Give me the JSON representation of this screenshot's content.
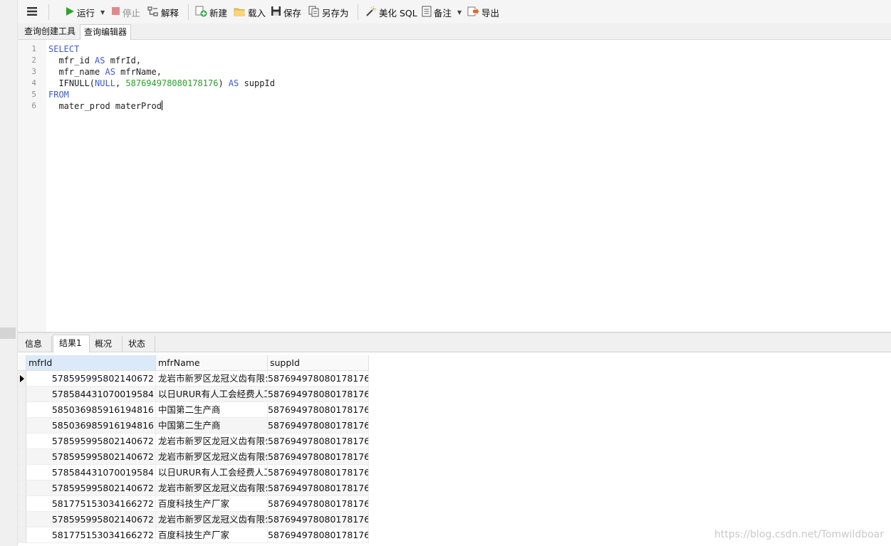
{
  "toolbar": {
    "run": "运行",
    "stop": "停止",
    "explain": "解释",
    "new": "新建",
    "load": "载入",
    "save": "保存",
    "save_as": "另存为",
    "beautify": "美化 SQL",
    "notes": "备注",
    "export": "导出",
    "colors": {
      "run_icon": "#2fa22f",
      "stop_icon": "#e08a8a",
      "new_icon": "#3aa54a",
      "export_icon": "#e06a28"
    }
  },
  "top_tabs": [
    "查询创建工具",
    "查询编辑器"
  ],
  "editor": {
    "line_numbers": [
      "1",
      "2",
      "3",
      "4",
      "5",
      "6"
    ],
    "l1_kw": "SELECT",
    "l2_a": "  mfr_id ",
    "l2_kw": "AS",
    "l2_b": " mfrId,",
    "l3_a": "  mfr_name ",
    "l3_kw": "AS",
    "l3_b": " mfrName,",
    "l4_a": "  IFNULL(",
    "l4_null": "NULL",
    "l4_comma": ", ",
    "l4_num": "587694978080178176",
    "l4_close": ") ",
    "l4_kw": "AS",
    "l4_b": " suppId",
    "l5_kw": "FROM",
    "l6": "  mater_prod materProd",
    "colors": {
      "keyword": "#3a5bcf",
      "number": "#2aa02a"
    }
  },
  "result_tabs": [
    "信息",
    "结果1",
    "概况",
    "状态"
  ],
  "grid": {
    "columns": [
      "mfrId",
      "mfrName",
      "suppId"
    ],
    "rows": [
      [
        "578595995802140672",
        "龙岩市新罗区龙冠义齿有限公",
        "587694978080178176"
      ],
      [
        "578584431070019584",
        "以日URUR有人工会经费人工",
        "587694978080178176"
      ],
      [
        "585036985916194816",
        "中国第二生产商",
        "587694978080178176"
      ],
      [
        "585036985916194816",
        "中国第二生产商",
        "587694978080178176"
      ],
      [
        "578595995802140672",
        "龙岩市新罗区龙冠义齿有限公",
        "587694978080178176"
      ],
      [
        "578595995802140672",
        "龙岩市新罗区龙冠义齿有限公",
        "587694978080178176"
      ],
      [
        "578584431070019584",
        "以日URUR有人工会经费人工",
        "587694978080178176"
      ],
      [
        "578595995802140672",
        "龙岩市新罗区龙冠义齿有限公",
        "587694978080178176"
      ],
      [
        "581775153034166272",
        "百度科技生产厂家",
        "587694978080178176"
      ],
      [
        "578595995802140672",
        "龙岩市新罗区龙冠义齿有限公",
        "587694978080178176"
      ],
      [
        "581775153034166272",
        "百度科技生产厂家",
        "587694978080178176"
      ]
    ]
  },
  "watermark": "https://blog.csdn.net/Tomwildboar"
}
